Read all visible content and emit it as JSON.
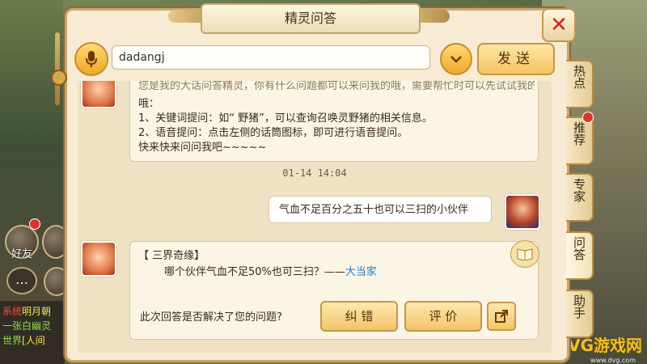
{
  "window": {
    "title": "精灵问答"
  },
  "input": {
    "value": "dadangj",
    "send_label": "发送"
  },
  "tabs": [
    {
      "label": "热点",
      "badge": false,
      "active": false
    },
    {
      "label": "推荐",
      "badge": true,
      "active": false
    },
    {
      "label": "专家",
      "badge": false,
      "active": false
    },
    {
      "label": "问答",
      "badge": false,
      "active": true
    },
    {
      "label": "助手",
      "badge": false,
      "active": false
    }
  ],
  "intro_message": {
    "line0": "您是我的大话问答精灵，你有什么问题都可以来问我的哦，需要帮忙时可以先试试我的这些提问方式",
    "line1": "哦：",
    "line2": "1、关键词提问：如“ 野猪”，可以查询召唤灵野猪的相关信息。",
    "line3": "2、语音提问：点击左侧的话筒图标，即可进行语音提问。",
    "line4": "快来快来问问我吧~~~~~"
  },
  "timestamp": "01-14 14:04",
  "user_message": "气血不足百分之五十也可以三扫的小伙伴",
  "answer": {
    "category": "【 三界奇缘】",
    "question": "哪个伙伴气血不足50%也可三扫？——",
    "link": "大当家",
    "feedback_prompt": "此次回答是否解决了您的问题?",
    "correct_label": "纠 错",
    "rate_label": "评 价"
  },
  "background": {
    "friends_label": "好友",
    "chat_lines": [
      {
        "tag": "系统",
        "text": "明月朝"
      },
      {
        "tag": "",
        "text": "一张白幽灵"
      },
      {
        "tag": "世界",
        "text": "[人间"
      }
    ],
    "watermark": "DVG游戏网",
    "watermark_sub": "www.dvg.com"
  },
  "colors": {
    "accent": "#f0a82c",
    "close": "#d3261f",
    "link": "#1a7fd1",
    "panel": "#f7ecd3"
  }
}
